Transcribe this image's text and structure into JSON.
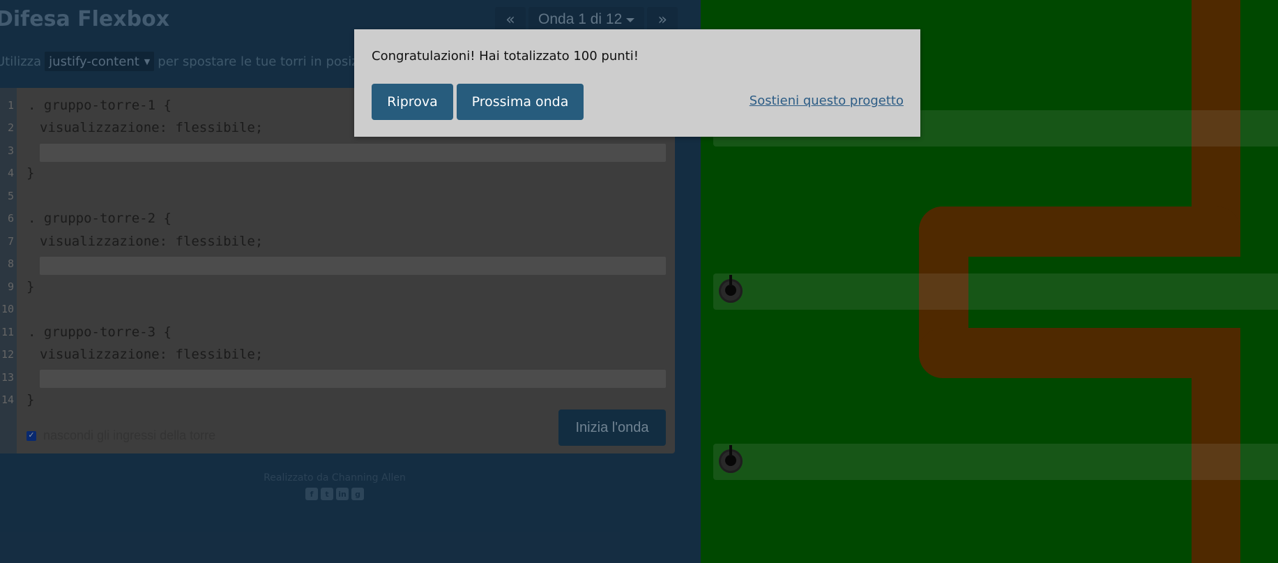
{
  "header": {
    "title": "Difesa Flexbox",
    "wave_select_label": "Onda 1 di 12",
    "prev_label": "«",
    "next_label": "»"
  },
  "instructions": {
    "prefix": "Utilizza",
    "property": "justify-content",
    "suffix": "per spostare le tue torri in posizio"
  },
  "editor": {
    "line_numbers": [
      "1",
      "2",
      "3",
      "4",
      "5",
      "6",
      "7",
      "8",
      "9",
      "10",
      "11",
      "12",
      "13",
      "14"
    ],
    "blocks": [
      {
        "selector": ". gruppo-torre-1 {",
        "declaration": "visualizzazione: flessibile;",
        "close": "}"
      },
      {
        "selector": ". gruppo-torre-2 {",
        "declaration": "visualizzazione: flessibile;",
        "close": "}"
      },
      {
        "selector": ". gruppo-torre-3 {",
        "declaration": "visualizzazione: flessibile;",
        "close": "}"
      }
    ],
    "hide_inputs_label": "nascondi gli ingressi della torre",
    "hide_inputs_checked": true,
    "start_wave_label": "Inizia l'onda"
  },
  "footer": {
    "credit": "Realizzato da Channing Allen",
    "socials": [
      "facebook-icon",
      "twitter-icon",
      "linkedin-icon",
      "github-icon"
    ]
  },
  "modal": {
    "message": "Congratulazioni! Hai totalizzato 100 punti!",
    "retry_label": "Riprova",
    "next_label": "Prossima onda",
    "support_link": "Sostieni questo progetto"
  },
  "colors": {
    "grass": "#006400",
    "path": "#6e3900",
    "modal_button": "#275c7d",
    "panel": "#1d3f5c"
  }
}
